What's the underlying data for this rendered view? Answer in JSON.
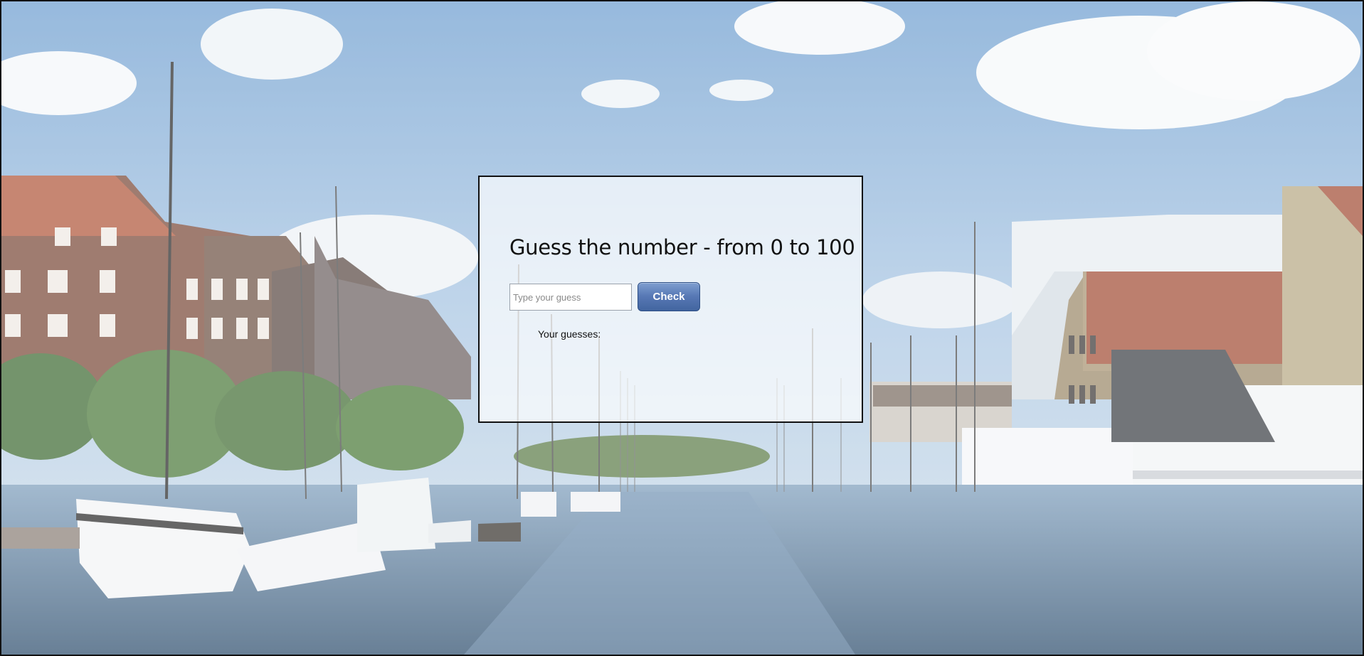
{
  "game": {
    "title": "Guess the number - from 0 to 100",
    "input_placeholder": "Type your guess",
    "input_value": "",
    "check_label": "Check",
    "guesses_label": "Your guesses:",
    "guesses": ""
  },
  "colors": {
    "button_top": "#7e9ed0",
    "button_bottom": "#42659f",
    "card_border": "#111111"
  }
}
